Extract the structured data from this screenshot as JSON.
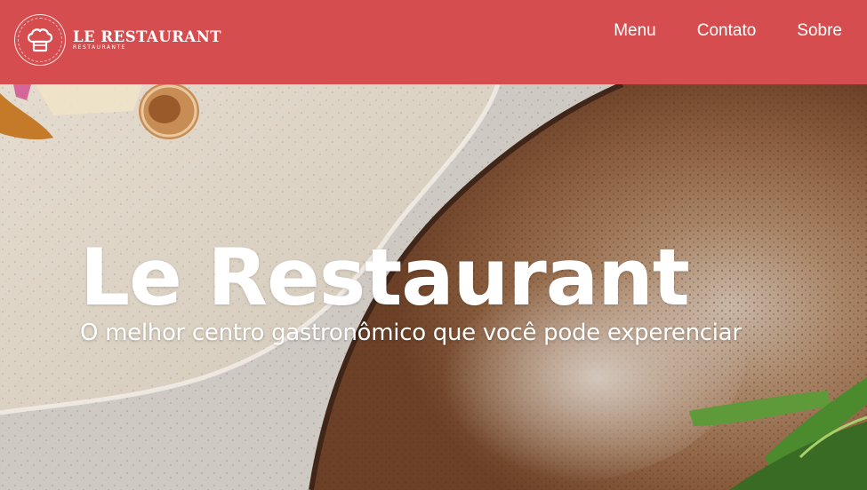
{
  "brand": {
    "name": "LE RESTAURANT",
    "tagline": "RESTAURANTE",
    "logo_icon": "chef-hat-icon",
    "color": "#d64d4f"
  },
  "nav": {
    "items": [
      {
        "label": "Menu"
      },
      {
        "label": "Contato"
      },
      {
        "label": "Sobre"
      }
    ]
  },
  "hero": {
    "title": "Le Restaurant",
    "subtitle": "O melhor centro gastronômico que você pode experenciar"
  }
}
